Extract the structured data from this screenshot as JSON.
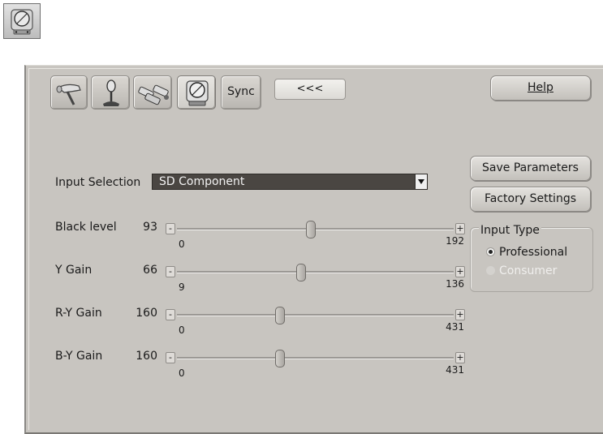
{
  "toolbar": {
    "tabs": [
      {
        "icon": "hairdryer-icon"
      },
      {
        "icon": "microphone-icon"
      },
      {
        "icon": "cables-icon"
      },
      {
        "icon": "video-monitor-icon",
        "active": true
      }
    ],
    "sync_label": "Sync",
    "collapse_label": "<<<",
    "help_label": "Help"
  },
  "buttons": {
    "save_label": "Save Parameters",
    "factory_label": "Factory Settings"
  },
  "input_selection": {
    "label": "Input Selection",
    "value": "SD Component"
  },
  "sliders": [
    {
      "name": "Black level",
      "value": "93",
      "min": "0",
      "max": "192",
      "pos": 0.484
    },
    {
      "name": "Y Gain",
      "value": "66",
      "min": "9",
      "max": "136",
      "pos": 0.449
    },
    {
      "name": "R-Y Gain",
      "value": "160",
      "min": "0",
      "max": "431",
      "pos": 0.371
    },
    {
      "name": "B-Y Gain",
      "value": "160",
      "min": "0",
      "max": "431",
      "pos": 0.371
    }
  ],
  "input_type": {
    "title": "Input Type",
    "options": [
      {
        "label": "Professional",
        "selected": true,
        "enabled": true
      },
      {
        "label": "Consumer",
        "selected": false,
        "enabled": false
      }
    ]
  },
  "colors": {
    "panel": "#c8c5c0",
    "select_bg": "#4a4642"
  }
}
